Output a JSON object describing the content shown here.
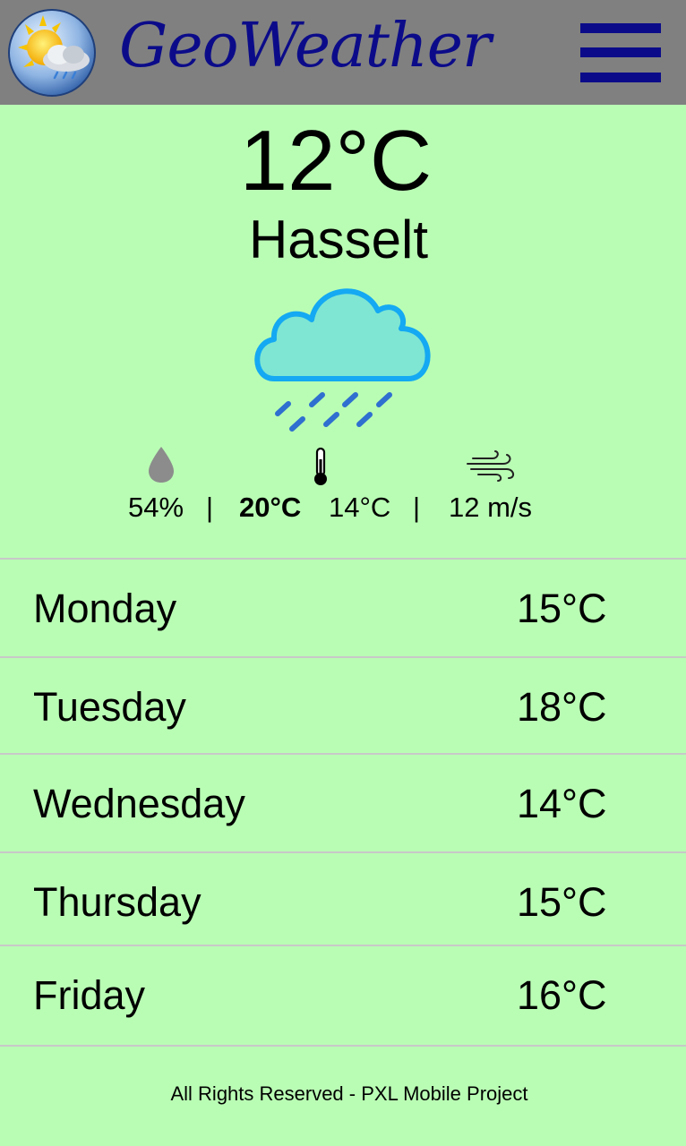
{
  "app": {
    "title": "GeoWeather",
    "logo_icon": "sun-cloud-rain-icon",
    "menu_icon": "hamburger-menu-icon",
    "header_color": "#808080",
    "brand_color": "#0b0b8a",
    "background_color": "#b9fdb4"
  },
  "current": {
    "temperature": "12°C",
    "city": "Hasselt",
    "condition_icon": "rain-cloud-icon",
    "humidity": "54%",
    "separator": "|",
    "temp_max": "20°C",
    "temp_min": "14°C",
    "wind": "12 m/s",
    "icons": {
      "humidity": "water-drop-icon",
      "temperature": "thermometer-icon",
      "wind": "wind-icon"
    }
  },
  "forecast": [
    {
      "day": "Monday",
      "temp": "15°C"
    },
    {
      "day": "Tuesday",
      "temp": "18°C"
    },
    {
      "day": "Wednesday",
      "temp": "14°C"
    },
    {
      "day": "Thursday",
      "temp": "15°C"
    },
    {
      "day": "Friday",
      "temp": "16°C"
    }
  ],
  "footer": {
    "text": "All Rights Reserved - PXL Mobile Project"
  }
}
